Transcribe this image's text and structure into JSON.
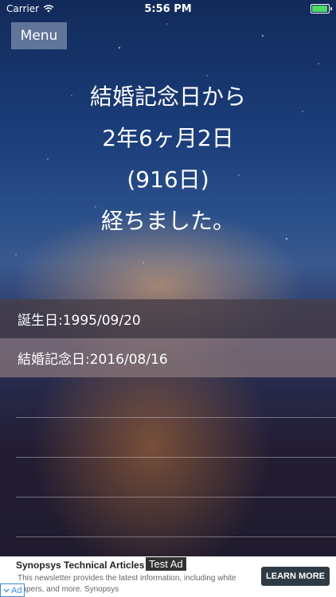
{
  "status_bar": {
    "carrier": "Carrier",
    "time": "5:56 PM"
  },
  "menu": {
    "label": "Menu"
  },
  "message": {
    "line1": "結婚記念日から",
    "line2": "2年6ヶ月2日",
    "line3": "(916日)",
    "line4": "経ちました。"
  },
  "dates": {
    "birthday": "誕生日:1995/09/20",
    "wedding": "結婚記念日:2016/08/16"
  },
  "ad": {
    "title": "Synopsys Technical Articles",
    "badge": "Test Ad",
    "description": "This newsletter provides the latest information, including white papers, and more. Synopsys",
    "cta": "LEARN MORE",
    "choice_label": "Ad"
  },
  "colors": {
    "battery_fill": "#4cd964",
    "cta_background": "#2f3b44"
  }
}
